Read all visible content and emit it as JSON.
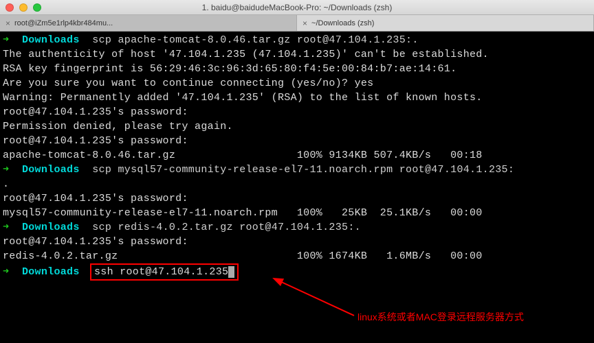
{
  "window": {
    "title": "1. baidu@baidudeMacBook-Pro: ~/Downloads (zsh)"
  },
  "tabs": [
    {
      "label": "root@iZm5e1rlp4kbr484mu..."
    },
    {
      "label": "~/Downloads (zsh)"
    }
  ],
  "terminal": {
    "cwd": "Downloads",
    "cmd1": "scp apache-tomcat-8.0.46.tar.gz root@47.104.1.235:.",
    "auth1": "The authenticity of host '47.104.1.235 (47.104.1.235)' can't be established.",
    "auth2": "RSA key fingerprint is 56:29:46:3c:96:3d:65:80:f4:5e:00:84:b7:ae:14:61.",
    "auth3": "Are you sure you want to continue connecting (yes/no)? yes",
    "auth4": "Warning: Permanently added '47.104.1.235' (RSA) to the list of known hosts.",
    "pw1": "root@47.104.1.235's password:",
    "perm": "Permission denied, please try again.",
    "pw2": "root@47.104.1.235's password:",
    "file1": "apache-tomcat-8.0.46.tar.gz                   100% 9134KB 507.4KB/s   00:18",
    "cmd2": "scp mysql57-community-release-el7-11.noarch.rpm root@47.104.1.235:",
    "dot": ".",
    "pw3": "root@47.104.1.235's password:",
    "file2": "mysql57-community-release-el7-11.noarch.rpm   100%   25KB  25.1KB/s   00:00",
    "cmd3": "scp redis-4.0.2.tar.gz root@47.104.1.235:.",
    "pw4": "root@47.104.1.235's password:",
    "file3": "redis-4.0.2.tar.gz                            100% 1674KB   1.6MB/s   00:00",
    "cmd4": "ssh root@47.104.1.235"
  },
  "annotation": "linux系统或者MAC登录远程服务器方式"
}
